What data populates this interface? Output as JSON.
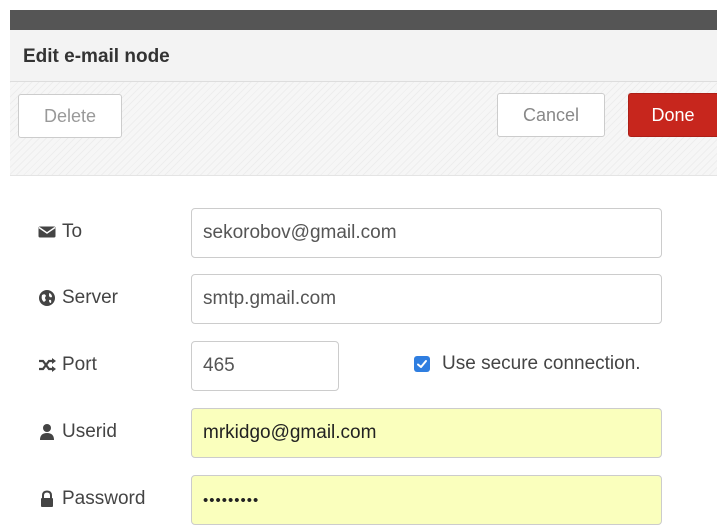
{
  "dialog": {
    "title": "Edit e-mail node"
  },
  "toolbar": {
    "delete_label": "Delete",
    "cancel_label": "Cancel",
    "done_label": "Done"
  },
  "form": {
    "to": {
      "label": "To",
      "icon": "envelope-icon",
      "value": "sekorobov@gmail.com"
    },
    "server": {
      "label": "Server",
      "icon": "globe-icon",
      "value": "smtp.gmail.com"
    },
    "port": {
      "label": "Port",
      "icon": "random-icon",
      "value": "465"
    },
    "secure": {
      "label": "Use secure connection.",
      "checked": true
    },
    "userid": {
      "label": "Userid",
      "icon": "user-icon",
      "value": "mrkidgo@gmail.com"
    },
    "password": {
      "label": "Password",
      "icon": "lock-icon",
      "value": "•••••••••"
    }
  },
  "colors": {
    "done_button": "#c7261d",
    "autofill_background": "#faffbd",
    "checkbox": "#2f7ee0"
  }
}
